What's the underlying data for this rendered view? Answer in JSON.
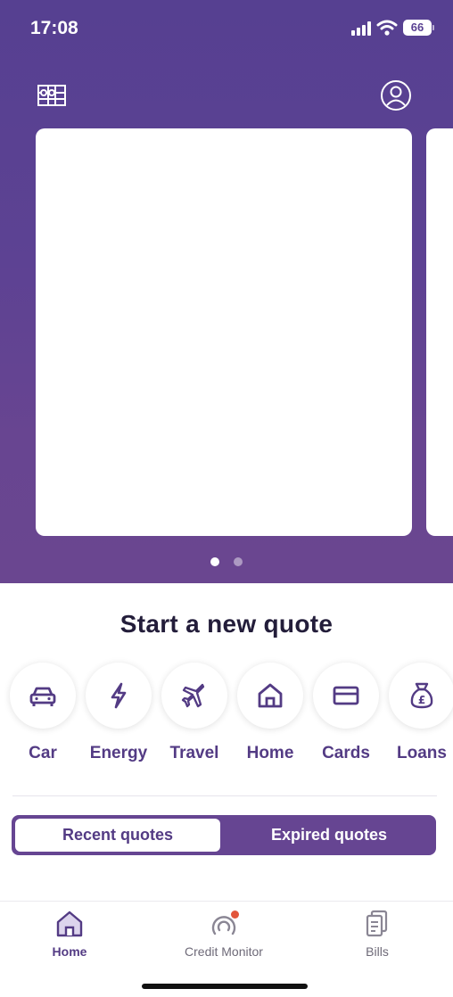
{
  "status_bar": {
    "time": "17:08",
    "battery": "66",
    "icons": [
      "signal-icon",
      "wifi-icon",
      "battery-icon"
    ]
  },
  "header": {
    "left_icon": "offers-icon",
    "right_icon": "account-icon"
  },
  "carousel": {
    "total_pages": 2,
    "active_page": 1
  },
  "quote_section": {
    "title": "Start a new quote",
    "items": [
      {
        "label": "Car",
        "icon": "car-icon"
      },
      {
        "label": "Energy",
        "icon": "lightning-icon"
      },
      {
        "label": "Travel",
        "icon": "plane-icon"
      },
      {
        "label": "Home",
        "icon": "house-icon"
      },
      {
        "label": "Cards",
        "icon": "card-icon"
      },
      {
        "label": "Loans",
        "icon": "money-bag-icon"
      }
    ]
  },
  "quotes_toggle": {
    "recent_label": "Recent quotes",
    "expired_label": "Expired quotes",
    "selected": "recent"
  },
  "tab_bar": {
    "tabs": [
      {
        "label": "Home",
        "icon": "home-icon",
        "active": true
      },
      {
        "label": "Credit Monitor",
        "icon": "credit-gauge-icon",
        "active": false,
        "has_badge": true
      },
      {
        "label": "Bills",
        "icon": "bills-icon",
        "active": false
      }
    ]
  },
  "colors": {
    "brand_purple": "#5d4293",
    "accent_purple": "#664592",
    "text_purple": "#533b84",
    "title_dark": "#231d3a",
    "badge_red": "#e2553b"
  }
}
